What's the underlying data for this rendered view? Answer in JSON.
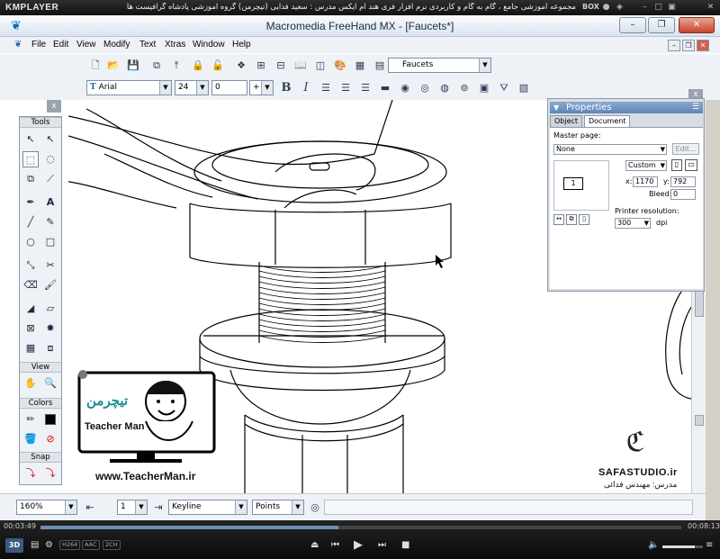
{
  "player": {
    "logo": "KMPLAYER",
    "title": "مجموعه آموزشی جامع ، گام به گام و کاربردی نرم افزار فری هند ام ایکس   مدرس : سعید فدایی (تیچرمن) گروه آموزشی پادشاه گرافیست ها",
    "box_label": "BOX",
    "time_elapsed": "00:03:49",
    "time_total": "00:08:13",
    "progress": 0.465,
    "volume": 0.8,
    "tags": [
      "H264",
      "AAC",
      "2CH"
    ],
    "badge_3d": "3D"
  },
  "window": {
    "title": "Macromedia FreeHand MX - [Faucets*]",
    "menu": [
      "File",
      "Edit",
      "View",
      "Modify",
      "Text",
      "Xtras",
      "Window",
      "Help"
    ]
  },
  "toolbar": {
    "style_select": "Faucets",
    "font_select": "Arial",
    "size_select": "24",
    "leading_select": "0",
    "leading_mode": "+"
  },
  "tools_panel": {
    "close": "x",
    "sections": [
      "Tools",
      "View",
      "Colors",
      "Snap"
    ]
  },
  "properties": {
    "close": "x",
    "title": "Properties",
    "tabs": [
      "Object",
      "Document"
    ],
    "master_page_label": "Master page:",
    "master_page_value": "None",
    "edit_button": "Edit...",
    "page_number": "1",
    "page_size": "Custom",
    "x_label": "x:",
    "x_value": "1170",
    "y_label": "y:",
    "y_value": "792",
    "bleed_label": "Bleed:",
    "bleed_value": "0",
    "printer_label": "Printer resolution:",
    "printer_value": "300",
    "dpi": "dpi"
  },
  "status": {
    "zoom": "160%",
    "page": "1",
    "view_mode": "Keyline",
    "units": "Points"
  },
  "watermarks": {
    "teacher_site": "www.TeacherMan.ir",
    "teacher_name": "Teacher Man",
    "teacher_persian": "تیچرمن",
    "safa_site": "SAFASTUDIO.ir",
    "safa_teacher": "مدرس: مهندس فدائی"
  }
}
